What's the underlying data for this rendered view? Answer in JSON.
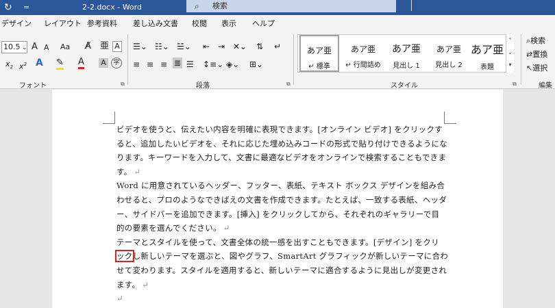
{
  "window": {
    "title": "2-2.docx  -  Word",
    "search_placeholder": "検索",
    "undo_glyph": "↻",
    "qat_glyph": "="
  },
  "tabs": [
    "デザイン",
    "レイアウト",
    "参考資料",
    "差し込み文書",
    "校閲",
    "表示",
    "ヘルプ"
  ],
  "ribbon": {
    "font": {
      "size": "10.5",
      "grow": "A",
      "shrink": "A",
      "change_case": "Aa",
      "subscript": "x",
      "superscript": "x",
      "text_effects": "A",
      "font_color": "A",
      "char_shading": "A",
      "char_border": "A",
      "enclose": "字",
      "label": "フォント"
    },
    "paragraph": {
      "label": "段落"
    },
    "styles": {
      "label": "スタイル",
      "items": [
        {
          "sample": "あア亜",
          "name": "標準",
          "prefix": "↵"
        },
        {
          "sample": "あア亜",
          "name": "行間詰め",
          "prefix": "↵"
        },
        {
          "sample": "あア亜",
          "name": "見出し 1",
          "prefix": ""
        },
        {
          "sample": "あア亜",
          "name": "見出し 2",
          "prefix": ""
        },
        {
          "sample": "あア亜",
          "name": "表題",
          "prefix": ""
        }
      ]
    },
    "editing": {
      "label": "編集",
      "find": "検索",
      "replace": "置換",
      "select": "選択"
    }
  },
  "document": {
    "lines": [
      "ビデオを使うと、伝えたい内容を明確に表現できます。[オンライン ビデオ] をクリックす",
      "ると、追加したいビデオを、それに応じた埋め込みコードの形式で貼り付けできるようにな",
      "ります。キーワードを入力して、文書に最適なビデオをオンラインで検索することもできま",
      "す。",
      "Word に用意されているヘッダー、フッター、表紙、テキスト ボックス デザインを組み合",
      "わせると、プロのようなできばえの文書を作成できます。たとえば、一致する表紙、ヘッダ",
      "ー、サイドバーを追加できます。[挿入] をクリックしてから、それぞれのギャラリーで目",
      "的の要素を選んでください。",
      "テーマとスタイルを使って、文書全体の統一感を出すこともできます。[デザイン] をクリ",
      "し新しいテーマを選ぶと、図やグラフ、SmartArt グラフィックが新しいテーマに合わ",
      "せて変わります。スタイルを適用すると、新しいテーマに適合するように見出しが変更され",
      "ます。",
      ""
    ],
    "highlighted_text": "ック",
    "paragraph_mark": "↵"
  }
}
